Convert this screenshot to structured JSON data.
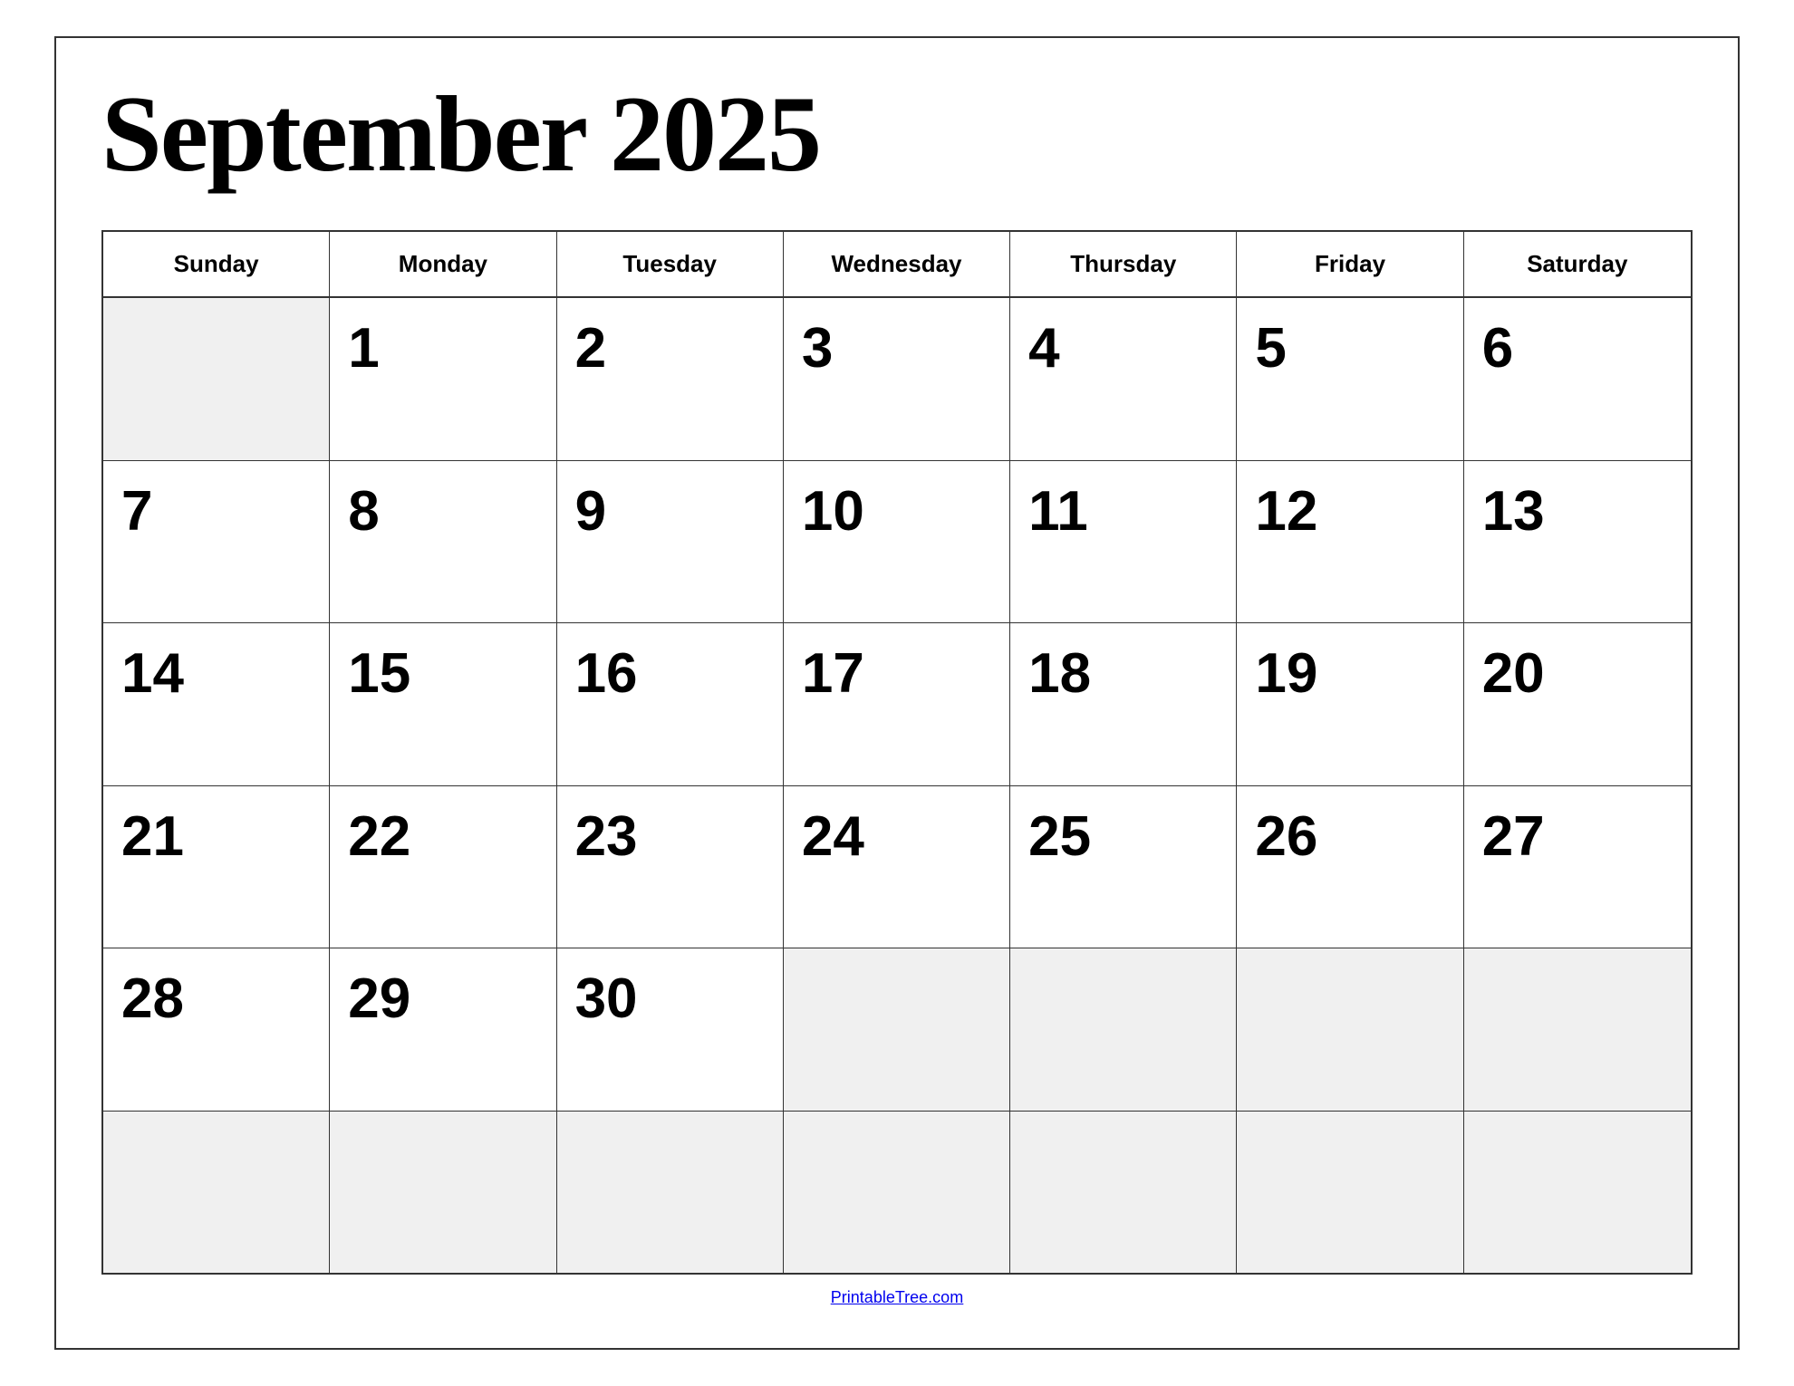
{
  "calendar": {
    "title": "September 2025",
    "footer_link": "PrintableTree.com",
    "days_of_week": [
      "Sunday",
      "Monday",
      "Tuesday",
      "Wednesday",
      "Thursday",
      "Friday",
      "Saturday"
    ],
    "weeks": [
      [
        {
          "day": "",
          "empty": true
        },
        {
          "day": "1",
          "empty": false
        },
        {
          "day": "2",
          "empty": false
        },
        {
          "day": "3",
          "empty": false
        },
        {
          "day": "4",
          "empty": false
        },
        {
          "day": "5",
          "empty": false
        },
        {
          "day": "6",
          "empty": false
        }
      ],
      [
        {
          "day": "7",
          "empty": false
        },
        {
          "day": "8",
          "empty": false
        },
        {
          "day": "9",
          "empty": false
        },
        {
          "day": "10",
          "empty": false
        },
        {
          "day": "11",
          "empty": false
        },
        {
          "day": "12",
          "empty": false
        },
        {
          "day": "13",
          "empty": false
        }
      ],
      [
        {
          "day": "14",
          "empty": false
        },
        {
          "day": "15",
          "empty": false
        },
        {
          "day": "16",
          "empty": false
        },
        {
          "day": "17",
          "empty": false
        },
        {
          "day": "18",
          "empty": false
        },
        {
          "day": "19",
          "empty": false
        },
        {
          "day": "20",
          "empty": false
        }
      ],
      [
        {
          "day": "21",
          "empty": false
        },
        {
          "day": "22",
          "empty": false
        },
        {
          "day": "23",
          "empty": false
        },
        {
          "day": "24",
          "empty": false
        },
        {
          "day": "25",
          "empty": false
        },
        {
          "day": "26",
          "empty": false
        },
        {
          "day": "27",
          "empty": false
        }
      ],
      [
        {
          "day": "28",
          "empty": false
        },
        {
          "day": "29",
          "empty": false
        },
        {
          "day": "30",
          "empty": false
        },
        {
          "day": "",
          "empty": true
        },
        {
          "day": "",
          "empty": true
        },
        {
          "day": "",
          "empty": true
        },
        {
          "day": "",
          "empty": true
        }
      ],
      [
        {
          "day": "",
          "empty": true
        },
        {
          "day": "",
          "empty": true
        },
        {
          "day": "",
          "empty": true
        },
        {
          "day": "",
          "empty": true
        },
        {
          "day": "",
          "empty": true
        },
        {
          "day": "",
          "empty": true
        },
        {
          "day": "",
          "empty": true
        }
      ]
    ]
  }
}
